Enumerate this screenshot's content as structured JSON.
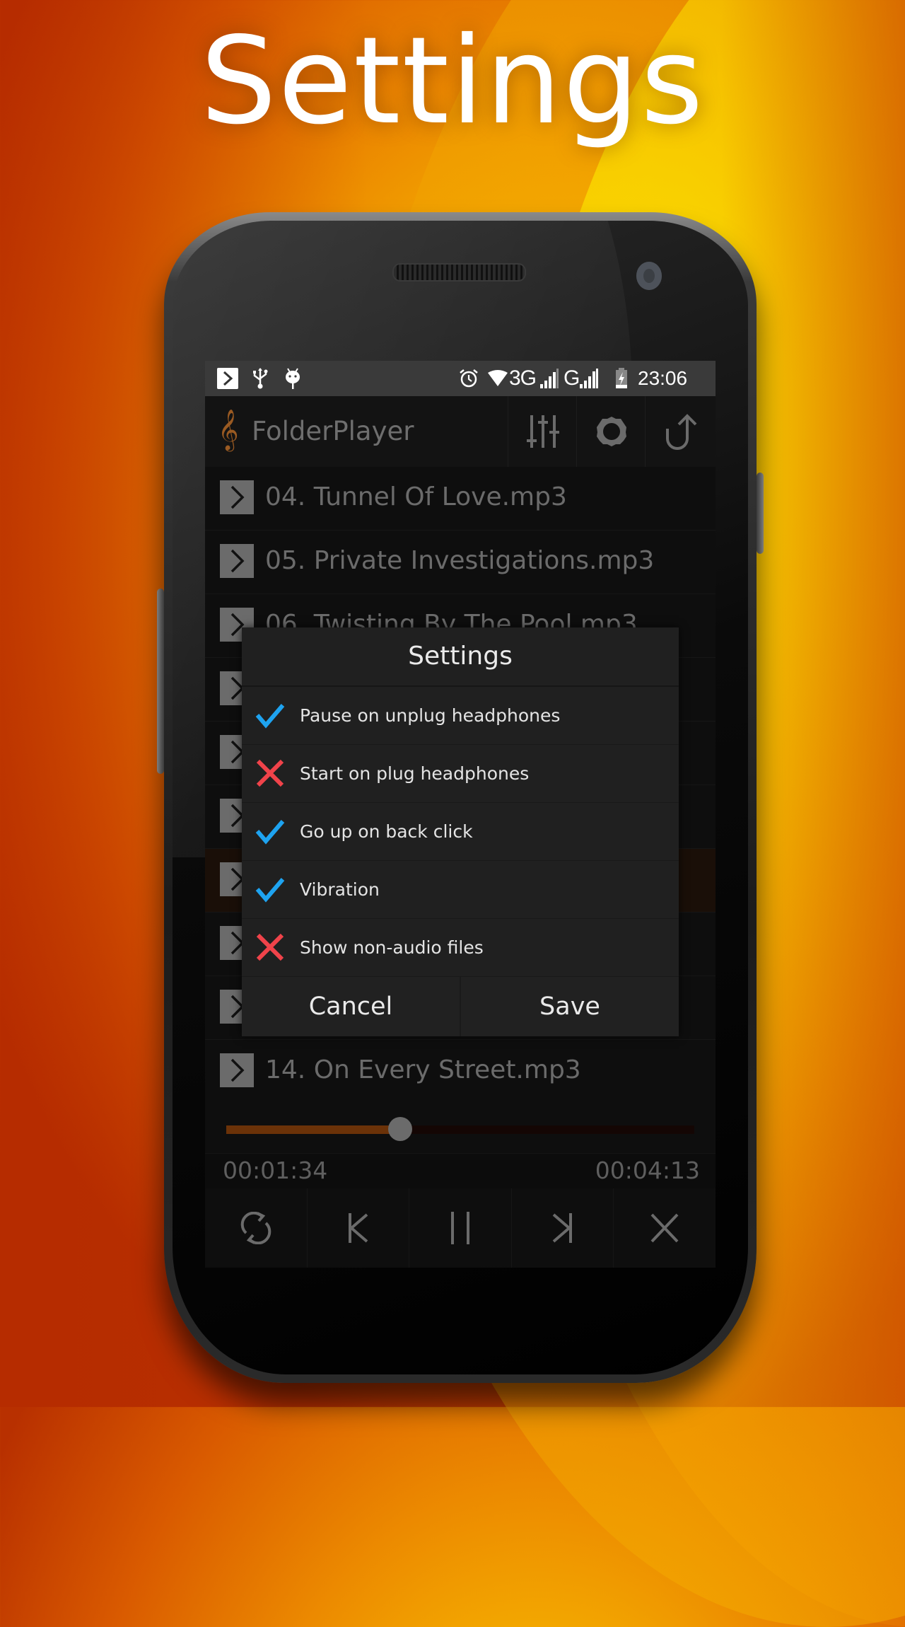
{
  "headline": "Settings",
  "status_bar": {
    "left_icons": [
      "play-store-notification-icon",
      "usb-icon",
      "android-debug-icon"
    ],
    "right_icons": [
      "alarm-icon",
      "wifi-icon",
      "signal-icon",
      "signal-icon",
      "battery-charging-icon"
    ],
    "network_1": "3G",
    "network_2": "G",
    "time": "23:06"
  },
  "toolbar": {
    "app_icon": "treble-clef-icon",
    "clef_glyph": "𝄞",
    "title": "FolderPlayer",
    "buttons": [
      {
        "name": "equalizer-button",
        "icon": "equalizer-icon"
      },
      {
        "name": "settings-button",
        "icon": "gear-icon"
      },
      {
        "name": "up-folder-button",
        "icon": "up-arrow-icon"
      }
    ]
  },
  "tracks": [
    {
      "label": "04. Tunnel Of Love.mp3",
      "active": false
    },
    {
      "label": "05. Private Investigations.mp3",
      "active": false
    },
    {
      "label": "06. Twisting By The Pool.mp3",
      "active": false
    },
    {
      "label": "",
      "active": false
    },
    {
      "label": "",
      "active": false
    },
    {
      "label": "",
      "active": false
    },
    {
      "label": "",
      "active": true
    },
    {
      "label": "",
      "active": false
    },
    {
      "label": "",
      "active": false
    },
    {
      "label": "14. On Every Street.mp3",
      "active": false
    }
  ],
  "player": {
    "elapsed": "00:01:34",
    "total": "00:04:13",
    "progress_fraction": 0.372,
    "accent_color": "#6b3208",
    "controls": [
      {
        "name": "repeat-button",
        "icon": "repeat-icon"
      },
      {
        "name": "previous-button",
        "icon": "previous-icon"
      },
      {
        "name": "pause-button",
        "icon": "pause-icon"
      },
      {
        "name": "next-button",
        "icon": "next-icon"
      },
      {
        "name": "close-button",
        "icon": "close-icon"
      }
    ]
  },
  "dialog": {
    "title": "Settings",
    "options": [
      {
        "label": "Pause on unplug headphones",
        "checked": true
      },
      {
        "label": "Start on plug headphones",
        "checked": false
      },
      {
        "label": "Go up on back click",
        "checked": true
      },
      {
        "label": "Vibration",
        "checked": true
      },
      {
        "label": "Show non-audio files",
        "checked": false
      }
    ],
    "cancel_label": "Cancel",
    "save_label": "Save",
    "check_color": "#1ea3f0",
    "cross_color": "#f0434a"
  }
}
